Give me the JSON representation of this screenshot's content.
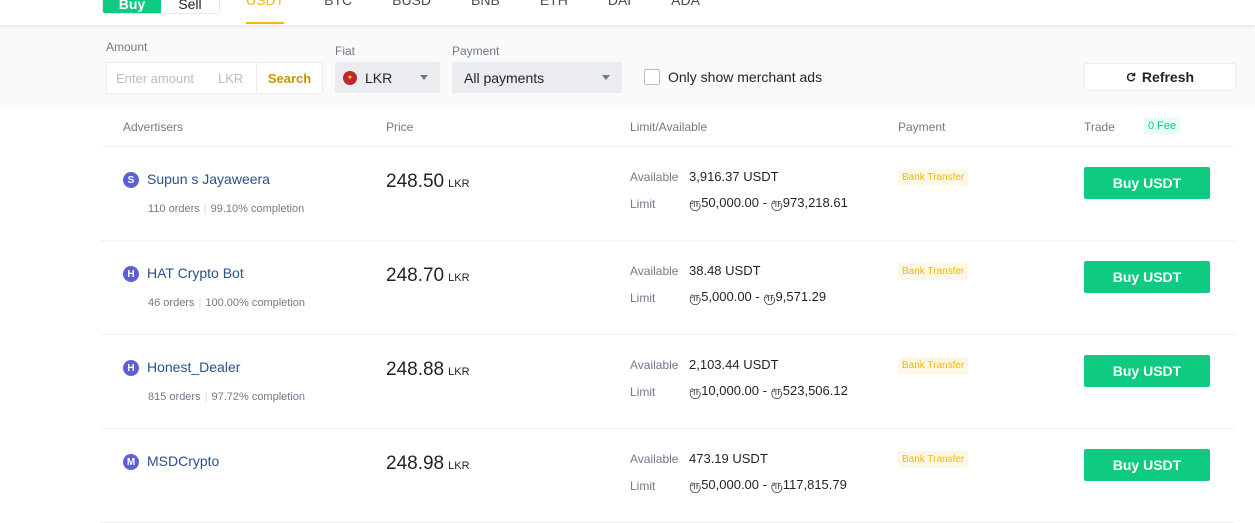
{
  "top": {
    "buy_label": "Buy",
    "sell_label": "Sell",
    "assets": [
      "USDT",
      "BTC",
      "BUSD",
      "BNB",
      "ETH",
      "DAI",
      "ADA"
    ],
    "active_asset": "USDT"
  },
  "filters": {
    "amount_label": "Amount",
    "amount_placeholder": "Enter amount",
    "amount_currency": "LKR",
    "search_label": "Search",
    "fiat_label": "Fiat",
    "fiat_value": "LKR",
    "payment_label": "Payment",
    "payment_value": "All payments",
    "merchant_only_label": "Only show merchant ads",
    "refresh_label": "Refresh"
  },
  "table": {
    "headers": {
      "advertisers": "Advertisers",
      "price": "Price",
      "limit": "Limit/Available",
      "payment": "Payment",
      "trade": "Trade",
      "fee_badge": "0 Fee"
    },
    "available_label": "Available",
    "limit_label": "Limit",
    "rows": [
      {
        "initial": "S",
        "name": "Supun s Jayaweera",
        "orders": "110 orders",
        "completion": "99.10% completion",
        "price": "248.50",
        "price_unit": "LKR",
        "available": "3,916.37 USDT",
        "limit": "ரூ50,000.00 - ரூ973,218.61",
        "payment": "Bank Transfer",
        "button": "Buy USDT"
      },
      {
        "initial": "H",
        "name": "HAT Crypto Bot",
        "orders": "46 orders",
        "completion": "100.00% completion",
        "price": "248.70",
        "price_unit": "LKR",
        "available": "38.48 USDT",
        "limit": "ரூ5,000.00 - ரூ9,571.29",
        "payment": "Bank Transfer",
        "button": "Buy USDT"
      },
      {
        "initial": "H",
        "name": "Honest_Dealer",
        "orders": "815 orders",
        "completion": "97.72% completion",
        "price": "248.88",
        "price_unit": "LKR",
        "available": "2,103.44 USDT",
        "limit": "ரூ10,000.00 - ரூ523,506.12",
        "payment": "Bank Transfer",
        "button": "Buy USDT"
      },
      {
        "initial": "M",
        "name": "MSDCrypto",
        "orders": "",
        "completion": "",
        "price": "248.98",
        "price_unit": "LKR",
        "available": "473.19 USDT",
        "limit": "ரூ50,000.00 - ரூ117,815.79",
        "payment": "Bank Transfer",
        "button": "Buy USDT"
      }
    ]
  },
  "colors": {
    "accent_green": "#0ecb81",
    "accent_yellow": "#f0b90b",
    "link_blue": "#2b4f8a"
  }
}
